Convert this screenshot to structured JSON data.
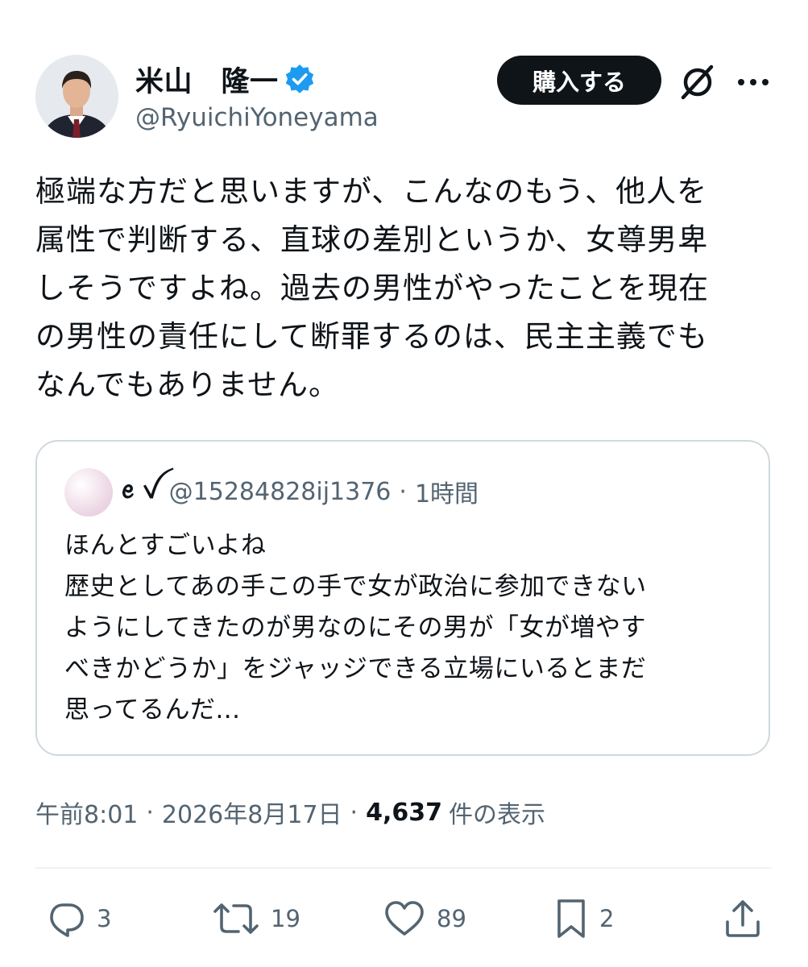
{
  "author": {
    "display_name": "米山　隆一",
    "handle": "@RyuichiYoneyama",
    "verified": true,
    "avatar": "portrait-photo"
  },
  "header_actions": {
    "buy_label": "購入する",
    "grok_icon": "slashed-circle-icon",
    "more_icon": "more-dots-icon"
  },
  "tweet": {
    "text": "極端な方だと思いますが、こんなのもう、他人を\n属性で判断する、直球の差別というか、女尊男卑\nしそうですよね。過去の男性がやったことを現在\nの男性の責任にして断罪するのは、民主主義でも\nなんでもありません。"
  },
  "quote": {
    "name": "ꫀ ꪜ",
    "handle": "@15284828ij1376",
    "separator": "·",
    "time": "1時間",
    "text": "ほんとすごいよね\n歴史としてあの手この手で女が政治に参加できない\nようにしてきたのが男なのにその男が「女が増やす\nべきかどうか」をジャッジできる立場にいるとまだ\n思ってるんだ..."
  },
  "meta": {
    "time": "午前8:01",
    "separator": "·",
    "date": "2026年8月17日",
    "views_count": "4,637",
    "views_label": "件の表示"
  },
  "actions": {
    "replies": "3",
    "retweets": "19",
    "likes": "89",
    "bookmarks": "2"
  },
  "colors": {
    "text": "#0f1419",
    "secondary": "#536471",
    "verified": "#1d9bf0",
    "border": "#cfd9de",
    "divider": "#eff3f4"
  }
}
